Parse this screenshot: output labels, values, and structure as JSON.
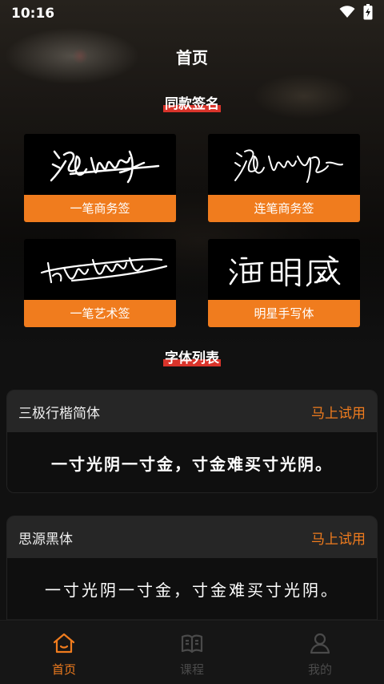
{
  "status_bar": {
    "time": "10:16",
    "icons": [
      "wifi-icon",
      "battery-charging-icon"
    ]
  },
  "page": {
    "title": "首页"
  },
  "signature_section": {
    "heading": "同款签名",
    "cards": [
      {
        "label": "一笔商务签",
        "signature_text": "海明威"
      },
      {
        "label": "连笔商务签",
        "signature_text": "海明威"
      },
      {
        "label": "一笔艺术签",
        "signature_text": "海明威"
      },
      {
        "label": "明星手写体",
        "signature_text": "海明威"
      }
    ]
  },
  "font_section": {
    "heading": "字体列表",
    "fonts": [
      {
        "name": "三极行楷简体",
        "action": "马上试用",
        "sample": "一寸光阴一寸金，寸金难买寸光阴。"
      },
      {
        "name": "思源黑体",
        "action": "马上试用",
        "sample": "一寸光阴一寸金，寸金难买寸光阴。"
      }
    ]
  },
  "tab_bar": {
    "tabs": [
      {
        "label": "首页",
        "icon": "home-icon",
        "active": true
      },
      {
        "label": "课程",
        "icon": "book-icon",
        "active": false
      },
      {
        "label": "我的",
        "icon": "user-icon",
        "active": false
      }
    ]
  },
  "colors": {
    "accent": "#f07c1e",
    "heading_underline": "#d9342b",
    "background": "#111111"
  }
}
